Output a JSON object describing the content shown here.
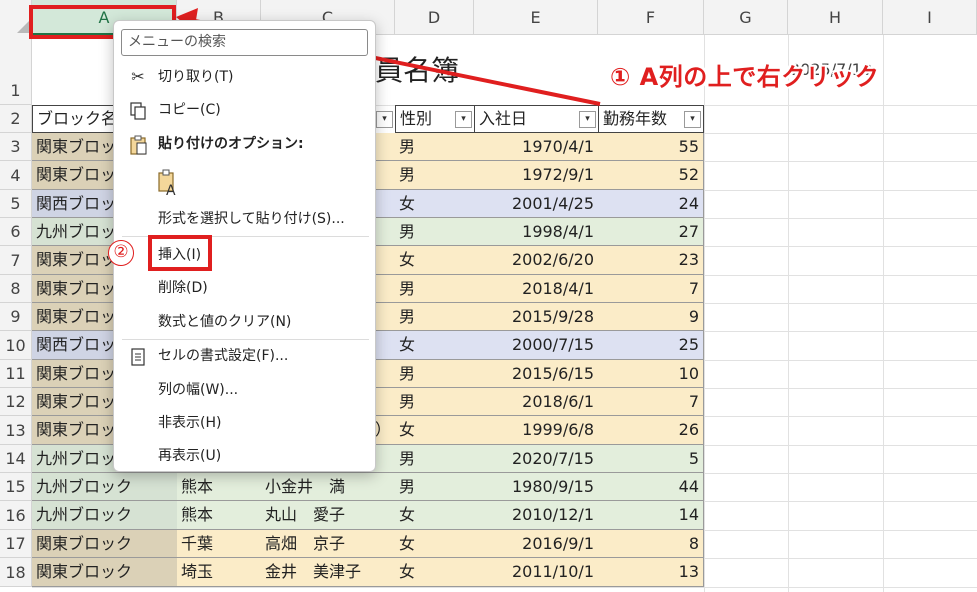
{
  "columns": [
    "A",
    "B",
    "C",
    "D",
    "E",
    "F",
    "G",
    "H",
    "I"
  ],
  "rows": [
    "1",
    "2",
    "3",
    "4",
    "5",
    "6",
    "7",
    "8",
    "9",
    "10",
    "11",
    "12",
    "13",
    "14",
    "15",
    "16",
    "17",
    "18"
  ],
  "sheet": {
    "title_partial": "員名簿",
    "date_partial": "2025/7/13",
    "headers": {
      "block": "ブロック名",
      "gender": "性別",
      "hire_date": "入社日",
      "years": "勤務年数",
      "filter_glyph": "▾"
    },
    "block_col": [
      "関東ブロック",
      "関東ブロック",
      "関西ブロック",
      "九州ブロック",
      "関東ブロック",
      "関東ブロック",
      "関東ブロック",
      "関西ブロック",
      "関東ブロック",
      "関東ブロック",
      "関東ブロック",
      "九州ブロック",
      "九州ブロック",
      "九州ブロック",
      "関東ブロック",
      "関東ブロック"
    ],
    "partial_row13_c": "）",
    "bottom_rows": [
      {
        "pref": "熊本",
        "name": "小金井　満"
      },
      {
        "pref": "熊本",
        "name": "丸山　愛子"
      },
      {
        "pref": "千葉",
        "name": "高畑　京子"
      },
      {
        "pref": "埼玉",
        "name": "金井　美津子"
      }
    ],
    "gender_col": [
      "男",
      "男",
      "女",
      "男",
      "女",
      "男",
      "男",
      "女",
      "男",
      "男",
      "女",
      "男",
      "男",
      "女",
      "女",
      "女"
    ],
    "hire_date_col": [
      "1970/4/1",
      "1972/9/1",
      "2001/4/25",
      "1998/4/1",
      "2002/6/20",
      "2018/4/1",
      "2015/9/28",
      "2000/7/15",
      "2015/6/15",
      "2018/6/1",
      "1999/6/8",
      "2020/7/15",
      "1980/9/15",
      "2010/12/1",
      "2016/9/1",
      "2011/10/1"
    ],
    "years_col": [
      "55",
      "52",
      "24",
      "27",
      "23",
      "7",
      "9",
      "25",
      "10",
      "7",
      "26",
      "5",
      "44",
      "14",
      "8",
      "13"
    ]
  },
  "annotation": {
    "step1": "① A列の上で右クリック",
    "step2": "②"
  },
  "context_menu": {
    "search_placeholder": "メニューの検索",
    "cut": "切り取り(T)",
    "copy": "コピー(C)",
    "paste_options": "貼り付けのオプション:",
    "paste_special": "形式を選択して貼り付け(S)...",
    "insert": "挿入(I)",
    "delete": "削除(D)",
    "clear_contents": "数式と値のクリア(N)",
    "format_cells": "セルの書式設定(F)...",
    "column_width": "列の幅(W)...",
    "hide": "非表示(H)",
    "unhide": "再表示(U)"
  },
  "colors": {
    "kanto": "#dbd1b7",
    "kansai": "#cfd4e4",
    "kyushu": "#d6e2d3",
    "female_row": "#dde1f2",
    "male_row": "#fbecc8",
    "green_row": "#e3eedc",
    "accent_red": "#e01f1f",
    "excel_green": "#217346"
  }
}
